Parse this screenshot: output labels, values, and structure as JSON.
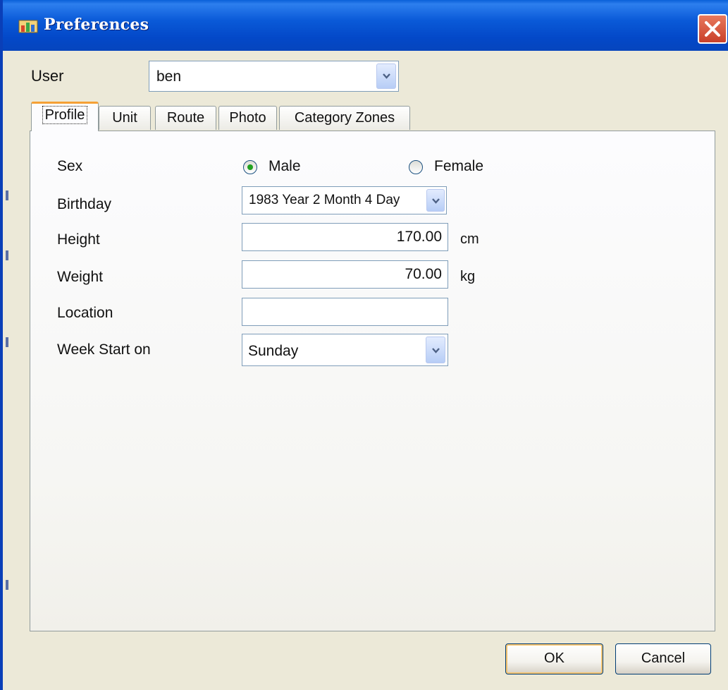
{
  "window": {
    "title": "Preferences",
    "title_icon": "preferences-app-icon",
    "close_icon": "close-icon"
  },
  "user": {
    "label": "User",
    "selected": "ben"
  },
  "tabs": [
    {
      "label": "Profile",
      "active": true
    },
    {
      "label": "Unit",
      "active": false
    },
    {
      "label": "Route",
      "active": false
    },
    {
      "label": "Photo",
      "active": false
    },
    {
      "label": "Category Zones",
      "active": false
    }
  ],
  "profile": {
    "sex": {
      "label": "Sex",
      "options": [
        {
          "label": "Male",
          "selected": true
        },
        {
          "label": "Female",
          "selected": false
        }
      ]
    },
    "birthday": {
      "label": "Birthday",
      "value": "1983 Year 2 Month 4 Day"
    },
    "height": {
      "label": "Height",
      "value": "170.00",
      "unit": "cm"
    },
    "weight": {
      "label": "Weight",
      "value": "70.00",
      "unit": "kg"
    },
    "location": {
      "label": "Location",
      "value": ""
    },
    "week_start": {
      "label": "Week Start on",
      "value": "Sunday"
    }
  },
  "buttons": {
    "ok": "OK",
    "cancel": "Cancel"
  },
  "colors": {
    "titlebar": "#0a5ad8",
    "window_bg": "#ece9d8",
    "active_tab_accent": "#f5a035",
    "radio_selected": "#21a121",
    "close_button": "#c9402a"
  }
}
